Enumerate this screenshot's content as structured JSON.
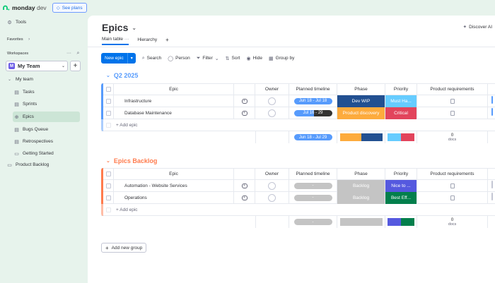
{
  "brand": {
    "name": "monday",
    "suffix": "dev",
    "see_plans": "See plans"
  },
  "sidebar": {
    "tools": "Tools",
    "favorites": "Favorites",
    "workspaces": "Workspaces",
    "team": {
      "initial": "M",
      "name": "My Team"
    },
    "my_team": "My team",
    "items": [
      {
        "label": "Tasks",
        "icon": "board-icon"
      },
      {
        "label": "Sprints",
        "icon": "board-icon"
      },
      {
        "label": "Epics",
        "icon": "globe-icon",
        "active": true
      },
      {
        "label": "Bugs Queue",
        "icon": "board-icon"
      },
      {
        "label": "Retrospectives",
        "icon": "board-icon"
      },
      {
        "label": "Getting Started",
        "icon": "doc-icon"
      }
    ],
    "product_backlog": "Product Backlog"
  },
  "page": {
    "title": "Epics",
    "discover_ai": "Discover AI",
    "tabs": [
      {
        "label": "Main table",
        "active": true
      },
      {
        "label": "Hierarchy"
      }
    ],
    "add_tab": "+"
  },
  "toolbar": {
    "new_label": "New epic",
    "search": "Search",
    "person": "Person",
    "filter": "Filter",
    "sort": "Sort",
    "hide": "Hide",
    "group_by": "Group by"
  },
  "columns": {
    "name": "Epic",
    "owner": "Owner",
    "timeline": "Planned timeline",
    "phase": "Phase",
    "priority": "Priority",
    "requirements": "Product requirements"
  },
  "groups": [
    {
      "title": "Q2 2025",
      "color": "#579bfc",
      "rows": [
        {
          "name": "Infrastructure",
          "timeline": "Jun 18 - Jul 18",
          "tl_color": "#579bfc",
          "phase": "Dev WIP",
          "phase_color": "#225091",
          "priority": "Must Ha...",
          "priority_color": "#66ccff"
        },
        {
          "name": "Database Maintenance",
          "timeline": "Jul 16 - 29",
          "tl_color": "split",
          "phase": "Product discovery",
          "phase_color": "#fdab3d",
          "priority": "Critical",
          "priority_color": "#e2445c"
        }
      ],
      "add_label": "+ Add epic",
      "summary": {
        "timeline": "Jun 18 - Jul 29",
        "docs_count": "0",
        "docs_label": "docs"
      }
    },
    {
      "title": "Epics Backlog",
      "color": "#ff7b4d",
      "rows": [
        {
          "name": "Automation - Website Services",
          "timeline": "-",
          "tl_color": "#c4c4c4",
          "phase": "Backlog",
          "phase_color": "#c4c4c4",
          "priority": "Nice to ...",
          "priority_color": "#5559df"
        },
        {
          "name": "Operations",
          "timeline": "-",
          "tl_color": "#c4c4c4",
          "phase": "Backlog",
          "phase_color": "#c4c4c4",
          "priority": "Best Eff...",
          "priority_color": "#037f4c"
        }
      ],
      "add_label": "+ Add epic",
      "summary": {
        "timeline": "-",
        "docs_count": "0",
        "docs_label": "docs"
      }
    }
  ],
  "add_group": "Add new group"
}
